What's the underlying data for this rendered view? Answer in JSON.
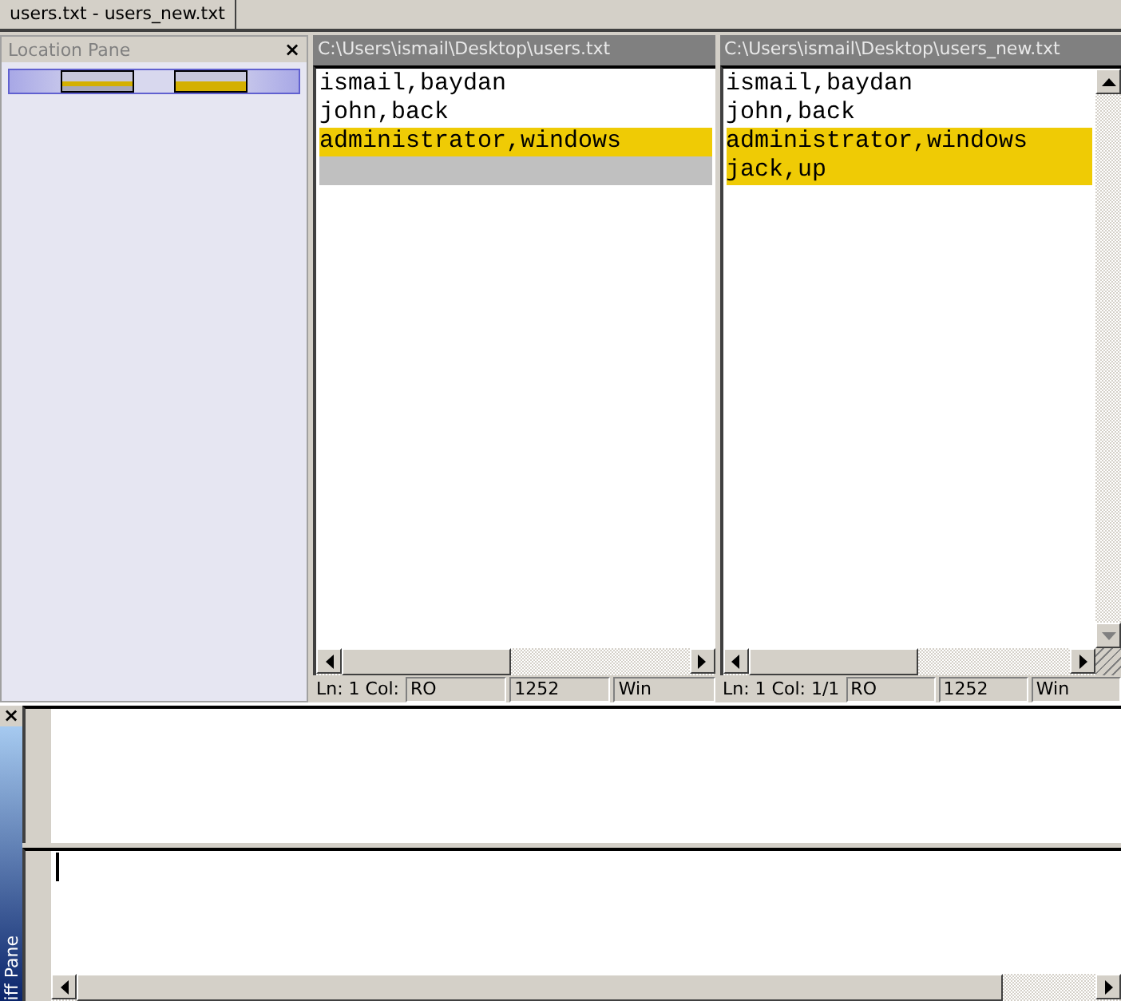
{
  "tab": {
    "label": "users.txt - users_new.txt",
    "selected": true
  },
  "location_pane": {
    "title": "Location Pane",
    "close": "×"
  },
  "panes": [
    {
      "path": "C:\\Users\\ismail\\Desktop\\users.txt",
      "has_vertical_scrollbar": false,
      "lines": [
        {
          "text": "ismail,baydan",
          "kind": "normal"
        },
        {
          "text": "john,back",
          "kind": "normal"
        },
        {
          "text": "administrator,windows",
          "kind": "changed"
        },
        {
          "kind": "missing"
        }
      ],
      "status": [
        "Ln: 1  Col:",
        "RO",
        "1252",
        "Win"
      ]
    },
    {
      "path": "C:\\Users\\ismail\\Desktop\\users_new.txt",
      "has_vertical_scrollbar": true,
      "lines": [
        {
          "text": "ismail,baydan",
          "kind": "normal"
        },
        {
          "text": "john,back",
          "kind": "normal"
        },
        {
          "text": "administrator,windows",
          "kind": "changed"
        },
        {
          "text": "jack,up",
          "kind": "changed"
        }
      ],
      "status": [
        "Ln: 1  Col: 1/1",
        "RO",
        "1252",
        "Win"
      ]
    }
  ],
  "diff_pane": {
    "title": "iff Pane",
    "close": "×"
  }
}
